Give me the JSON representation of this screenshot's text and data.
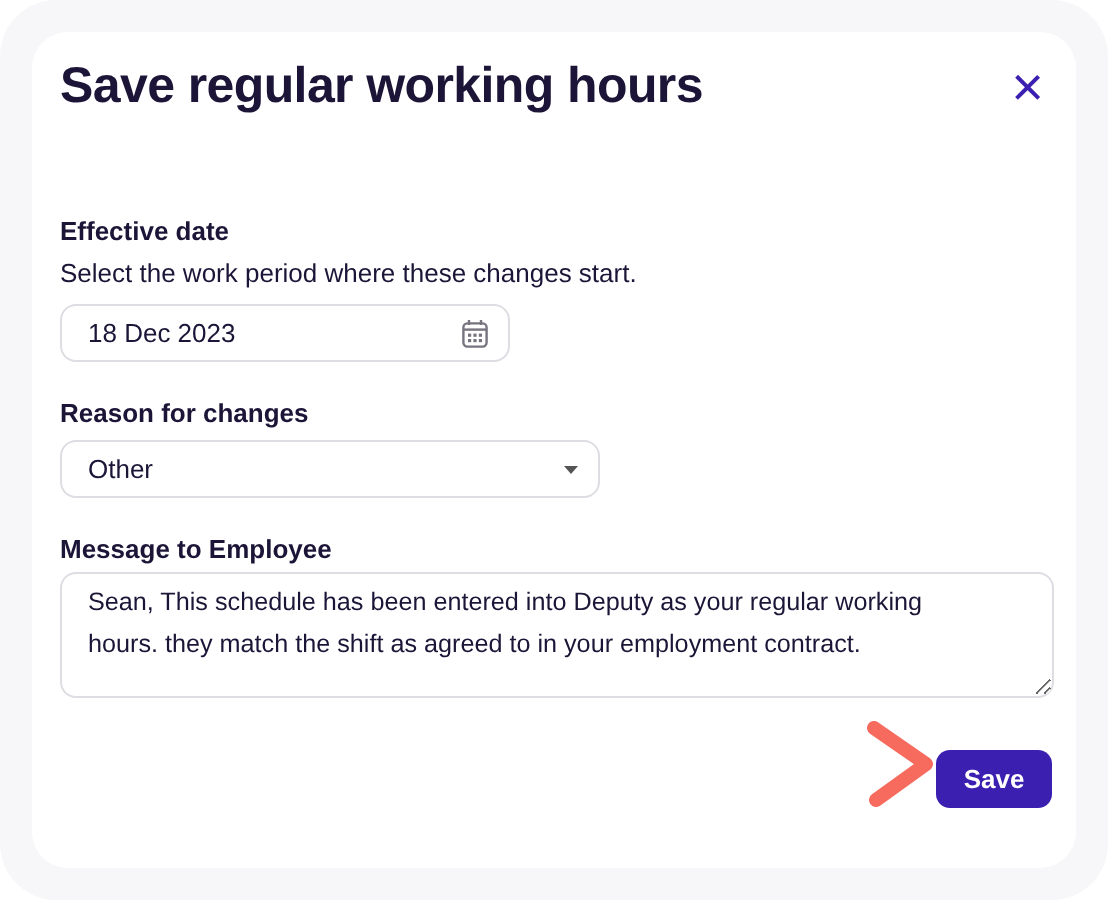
{
  "dialog": {
    "title": "Save regular working hours",
    "close": "×"
  },
  "effective_date": {
    "label": "Effective date",
    "hint": "Select the work period where these changes start.",
    "value": "18 Dec 2023"
  },
  "reason": {
    "label": "Reason for changes",
    "value": "Other"
  },
  "message": {
    "label": "Message to Employee",
    "value": "Sean, This schedule has been entered into Deputy as your regular working hours. they match the shift as agreed to in your employment contract."
  },
  "buttons": [
    "Save"
  ]
}
